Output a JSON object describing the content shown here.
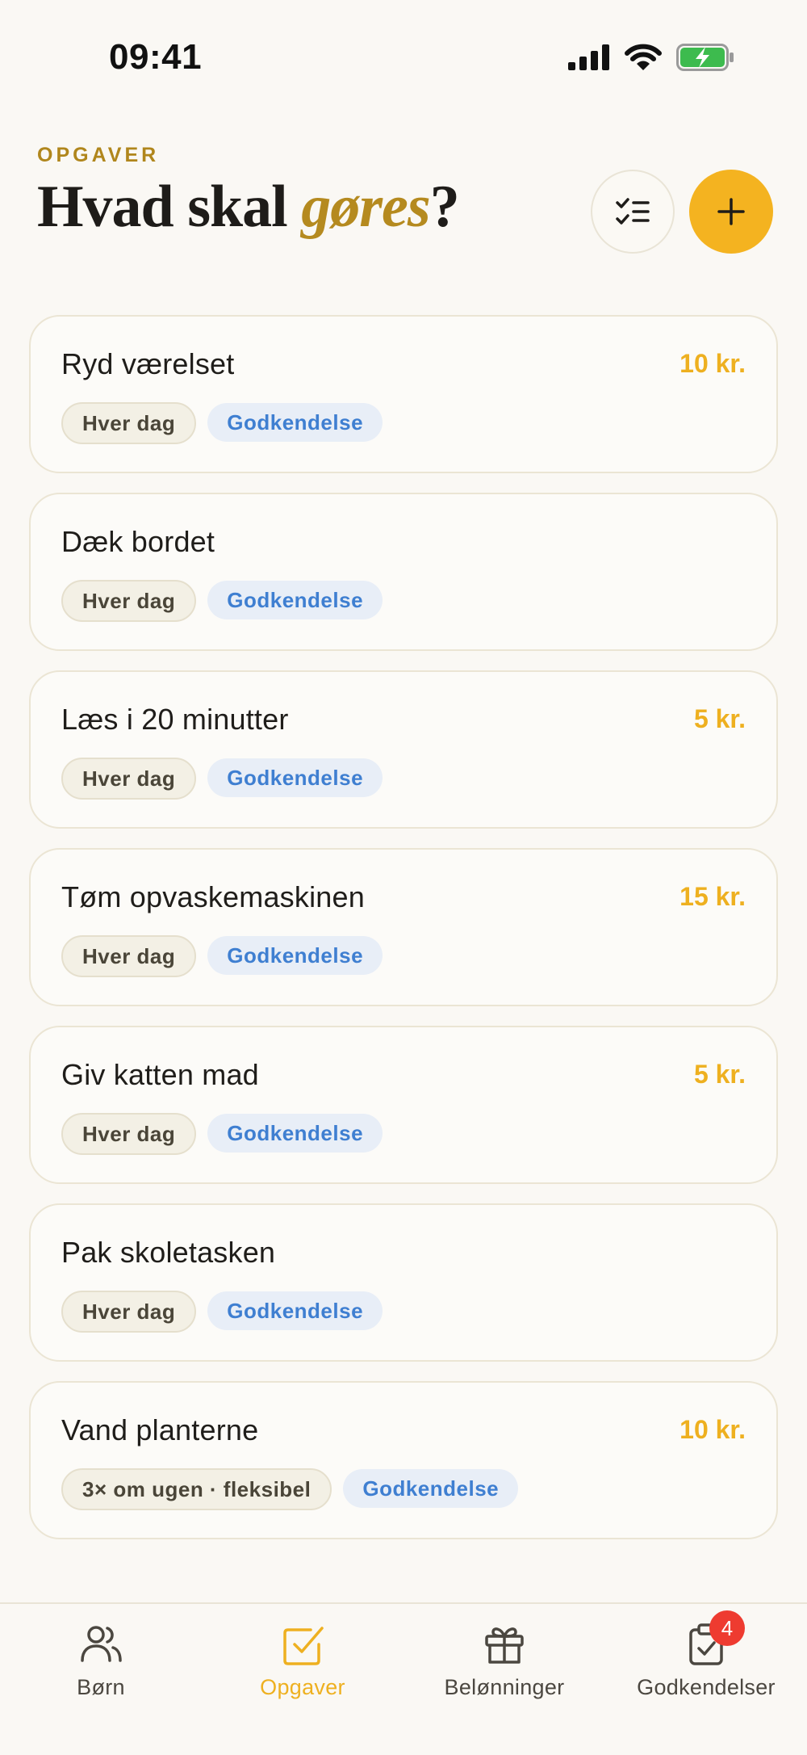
{
  "status_bar": {
    "time": "09:41"
  },
  "header": {
    "eyebrow": "OPGAVER",
    "title_before": "Hvad skal ",
    "title_accent": "gøres",
    "title_after": "?"
  },
  "tasks": [
    {
      "name": "Ryd værelset",
      "reward": "10 kr.",
      "frequency": "Hver dag",
      "approval": "Godkendelse"
    },
    {
      "name": "Dæk bordet",
      "reward": "",
      "frequency": "Hver dag",
      "approval": "Godkendelse"
    },
    {
      "name": "Læs i 20 minutter",
      "reward": "5 kr.",
      "frequency": "Hver dag",
      "approval": "Godkendelse"
    },
    {
      "name": "Tøm opvaskemaskinen",
      "reward": "15 kr.",
      "frequency": "Hver dag",
      "approval": "Godkendelse"
    },
    {
      "name": "Giv katten mad",
      "reward": "5 kr.",
      "frequency": "Hver dag",
      "approval": "Godkendelse"
    },
    {
      "name": "Pak skoletasken",
      "reward": "",
      "frequency": "Hver dag",
      "approval": "Godkendelse"
    },
    {
      "name": "Vand planterne",
      "reward": "10 kr.",
      "frequency": "3× om ugen · fleksibel",
      "approval": "Godkendelse"
    }
  ],
  "tab_bar": {
    "tabs": [
      {
        "label": "Børn",
        "icon": "users-icon",
        "active": false
      },
      {
        "label": "Opgaver",
        "icon": "checkbox-icon",
        "active": true
      },
      {
        "label": "Belønninger",
        "icon": "gift-icon",
        "active": false
      },
      {
        "label": "Godkendelser",
        "icon": "clipboard-check-icon",
        "active": false,
        "badge": "4"
      }
    ]
  },
  "colors": {
    "accent": "#f4b320",
    "reward": "#eeb020",
    "approval_text": "#3f7fd1",
    "badge": "#ee3b30"
  }
}
